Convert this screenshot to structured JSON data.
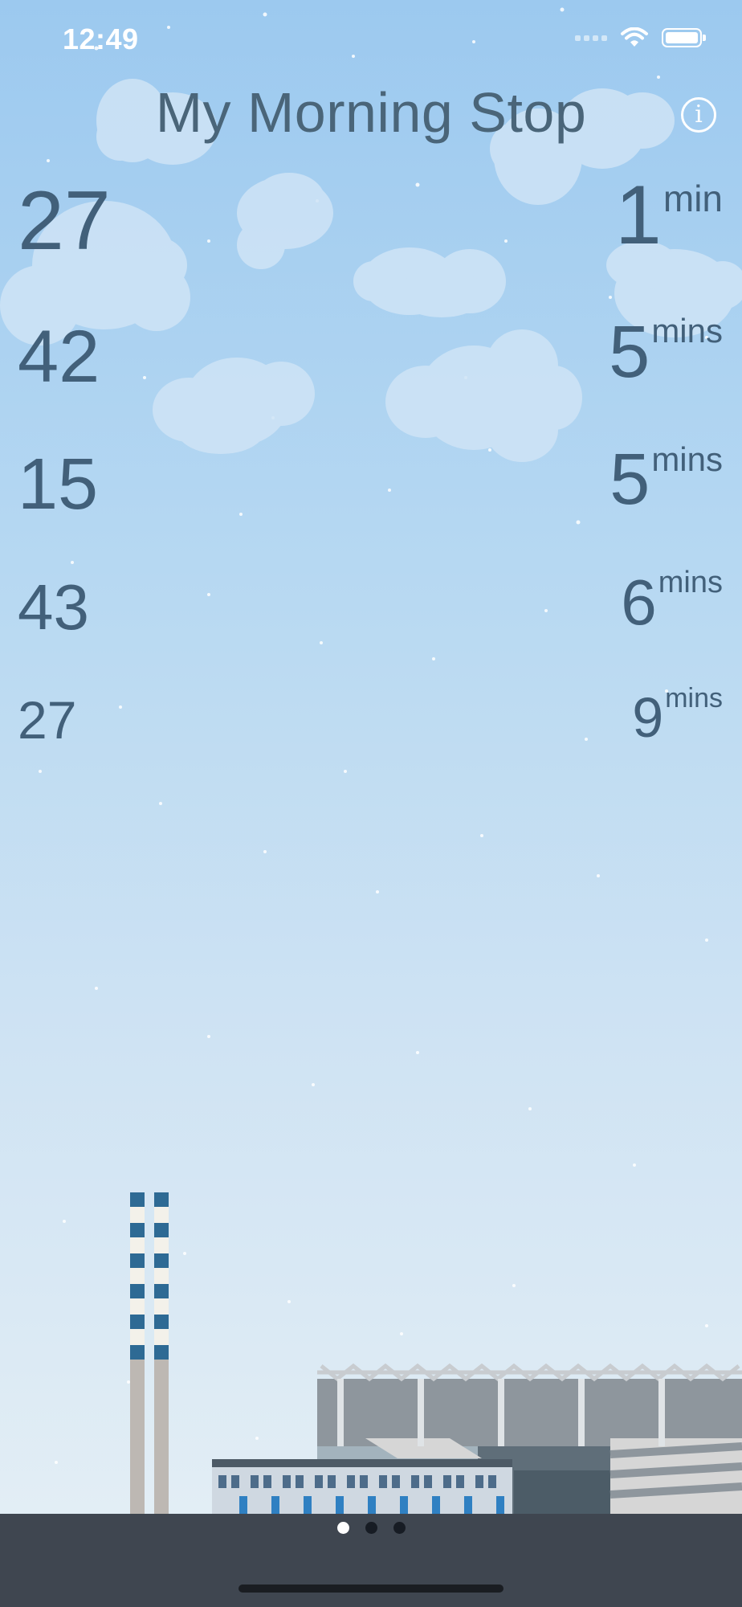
{
  "status_bar": {
    "time": "12:49"
  },
  "header": {
    "title": "My Morning Stop",
    "info_icon": "info-icon",
    "info_glyph": "i"
  },
  "departures": [
    {
      "route": "27",
      "eta": "1",
      "unit": "min"
    },
    {
      "route": "42",
      "eta": "5",
      "unit": "mins"
    },
    {
      "route": "15",
      "eta": "5",
      "unit": "mins"
    },
    {
      "route": "43",
      "eta": "6",
      "unit": "mins"
    },
    {
      "route": "27",
      "eta": "9",
      "unit": "mins"
    }
  ],
  "pager": {
    "page_count": 3,
    "current_page": 1
  },
  "colors": {
    "sky_top": "#9cc9ef",
    "sky_bottom": "#e6eff4",
    "text": "#42607a",
    "ground": "#3f4650"
  }
}
